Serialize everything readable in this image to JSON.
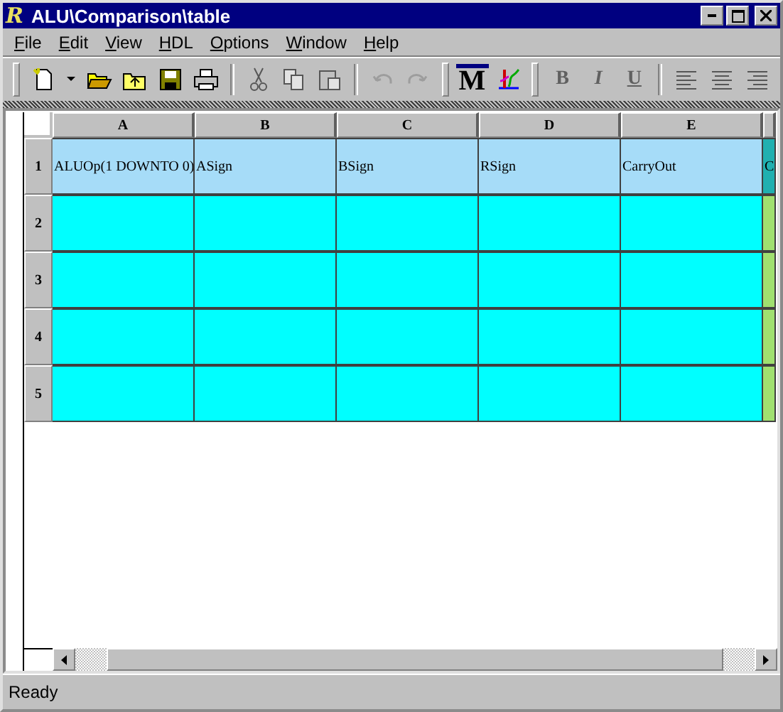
{
  "window": {
    "logo": "R",
    "title": "ALU\\Comparison\\table"
  },
  "menu": [
    "File",
    "Edit",
    "View",
    "HDL",
    "Options",
    "Window",
    "Help"
  ],
  "toolbar": [
    [
      {
        "kind": "new",
        "disabled": false
      },
      {
        "kind": "dropdown",
        "disabled": false
      },
      {
        "kind": "open",
        "disabled": false
      },
      {
        "kind": "up-folder",
        "disabled": false
      },
      {
        "kind": "save",
        "disabled": false
      },
      {
        "kind": "print",
        "disabled": false
      }
    ],
    [
      {
        "kind": "cut",
        "disabled": true
      },
      {
        "kind": "copy",
        "disabled": true
      },
      {
        "kind": "paste",
        "disabled": true
      }
    ],
    [
      {
        "kind": "undo",
        "disabled": true
      },
      {
        "kind": "redo",
        "disabled": true
      }
    ],
    [
      {
        "kind": "letter",
        "label": "M",
        "disabled": false
      },
      {
        "kind": "wave",
        "disabled": false
      }
    ],
    [
      {
        "kind": "letter",
        "label": "B",
        "disabled": true
      },
      {
        "kind": "letter",
        "label": "I",
        "disabled": true
      },
      {
        "kind": "letter",
        "label": "U",
        "disabled": true
      }
    ],
    [
      {
        "kind": "align-left",
        "disabled": true
      },
      {
        "kind": "align-center",
        "disabled": true
      },
      {
        "kind": "align-right",
        "disabled": true
      }
    ]
  ],
  "table": {
    "columns": [
      "A",
      "B",
      "C",
      "D",
      "E"
    ],
    "rows": [
      {
        "number": "1",
        "kind": "names",
        "cells": [
          "ALUOp(1 DOWNTO 0)",
          "ASign",
          "BSign",
          "RSign",
          "CarryOut",
          "C"
        ]
      },
      {
        "number": "2",
        "kind": "values",
        "cells": []
      },
      {
        "number": "3",
        "kind": "values",
        "cells": []
      },
      {
        "number": "4",
        "kind": "values",
        "cells": []
      },
      {
        "number": "5",
        "kind": "values",
        "cells": []
      }
    ]
  },
  "status_bar": "Ready"
}
